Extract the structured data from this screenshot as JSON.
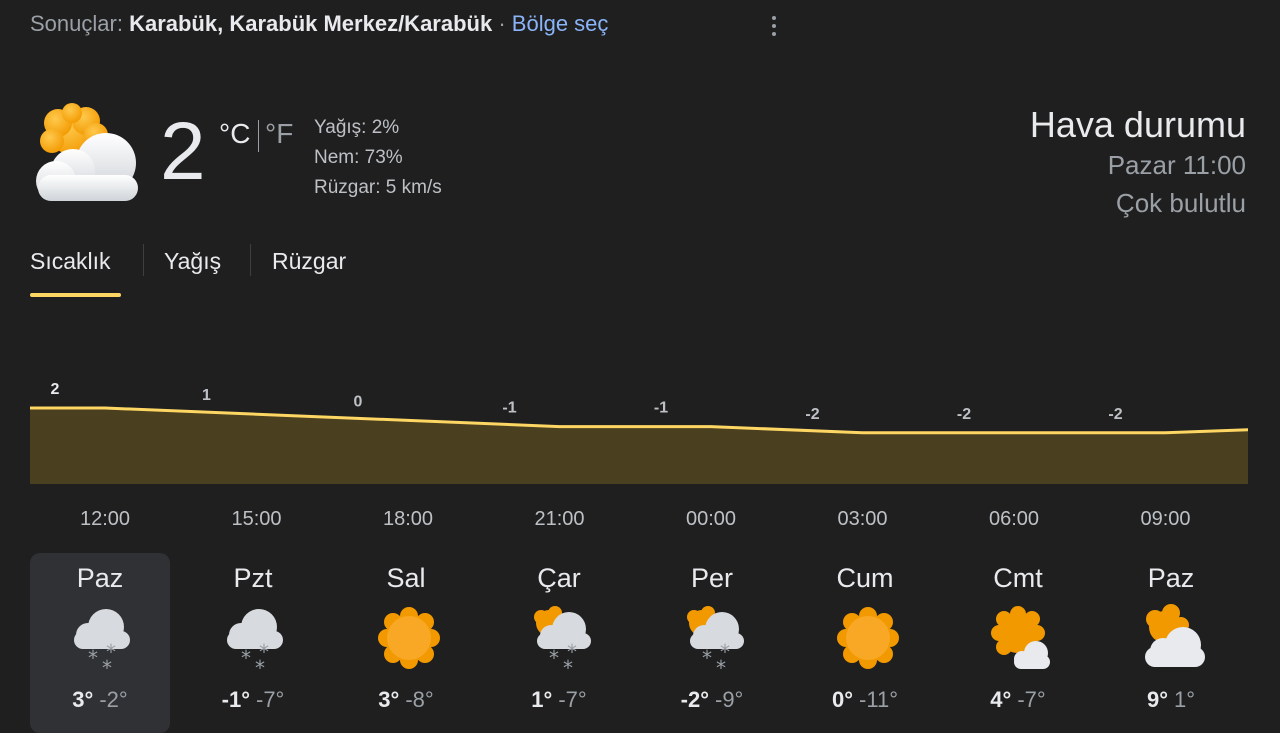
{
  "header": {
    "results_label": "Sonuçlar:",
    "location": "Karabük, Karabük Merkez/Karabük",
    "separator": "·",
    "region_link": "Bölge seç"
  },
  "current": {
    "icon": "sun-behind-cloud-icon",
    "temperature": "2",
    "unit_c": "°C",
    "unit_f": "°F",
    "precip": "Yağış: 2%",
    "humidity": "Nem: 73%",
    "wind": "Rüzgar: 5 km/s",
    "title": "Hava durumu",
    "time": "Pazar 11:00",
    "condition": "Çok bulutlu"
  },
  "tabs": [
    "Sıcaklık",
    "Yağış",
    "Rüzgar"
  ],
  "chart_data": {
    "type": "area",
    "x": [
      "12:00",
      "15:00",
      "18:00",
      "21:00",
      "00:00",
      "03:00",
      "06:00",
      "09:00"
    ],
    "values": [
      2,
      1,
      0,
      -1,
      -1,
      -2,
      -2,
      -2
    ],
    "labels": [
      "2",
      "1",
      "0",
      "-1",
      "-1",
      "-2",
      "-2",
      "-2"
    ],
    "line_color": "#fdd663",
    "fill_color": "#4a3f1e"
  },
  "days": [
    {
      "name": "Paz",
      "icon": "cloud-snow-icon",
      "high": "3°",
      "low": "-2°",
      "selected": true
    },
    {
      "name": "Pzt",
      "icon": "cloud-snow-icon",
      "high": "-1°",
      "low": "-7°"
    },
    {
      "name": "Sal",
      "icon": "sun-icon",
      "high": "3°",
      "low": "-8°"
    },
    {
      "name": "Çar",
      "icon": "sun-cloud-snow-icon",
      "high": "1°",
      "low": "-7°"
    },
    {
      "name": "Per",
      "icon": "sun-cloud-snow-icon",
      "high": "-2°",
      "low": "-9°"
    },
    {
      "name": "Cum",
      "icon": "sun-icon",
      "high": "0°",
      "low": "-11°"
    },
    {
      "name": "Cmt",
      "icon": "sun-small-cloud-icon",
      "high": "4°",
      "low": "-7°"
    },
    {
      "name": "Paz",
      "icon": "sun-behind-cloud-icon",
      "high": "9°",
      "low": "1°"
    }
  ]
}
